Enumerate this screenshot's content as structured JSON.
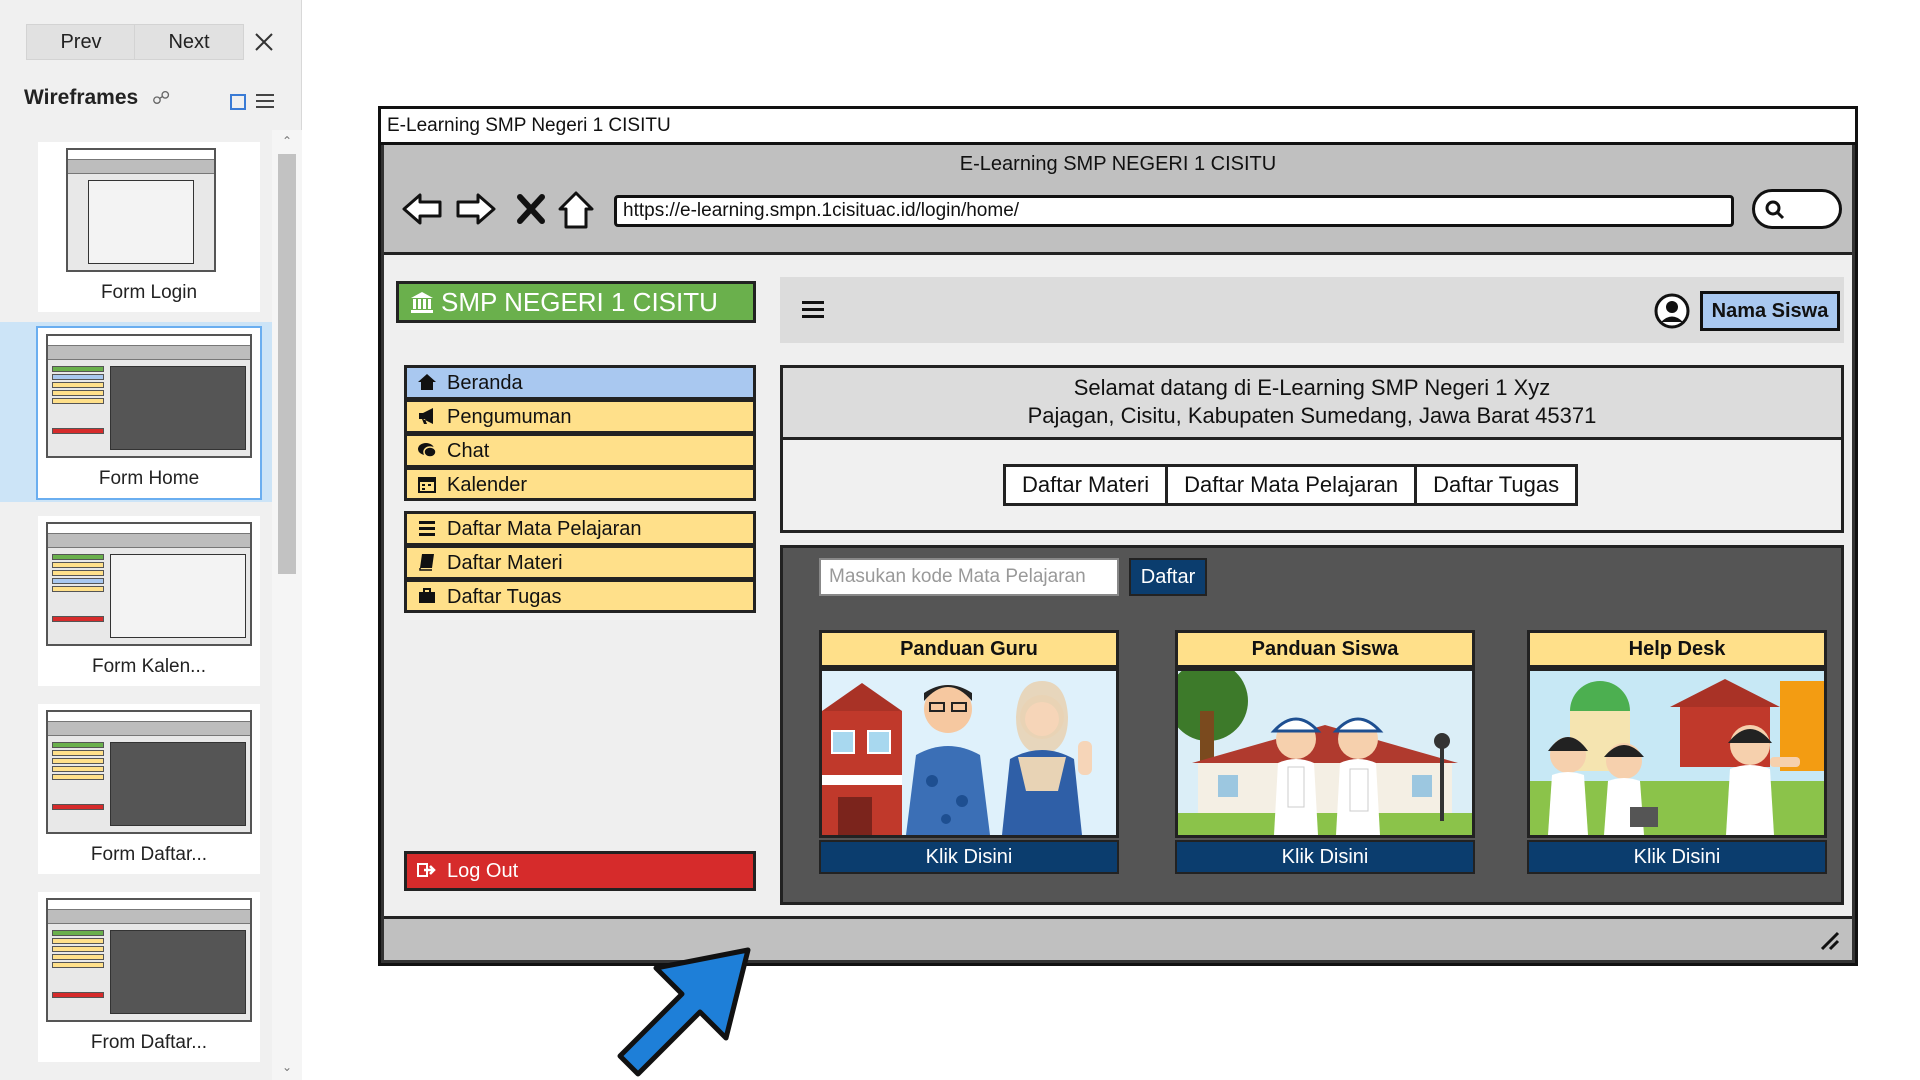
{
  "left_panel": {
    "prev_label": "Prev",
    "next_label": "Next",
    "header_title": "Wireframes",
    "thumbnails": [
      {
        "label": "Form Login"
      },
      {
        "label": "Form Home"
      },
      {
        "label": "Form Kalen..."
      },
      {
        "label": "Form Daftar..."
      },
      {
        "label": "From Daftar..."
      }
    ]
  },
  "mockup": {
    "window_title": "E-Learning SMP Negeri 1 CISITU",
    "page_title": "E-Learning SMP NEGERI 1 CISITU",
    "url": "https://e-learning.smpn.1cisituac.id/login/home/",
    "logo_text": "SMP NEGERI 1 CISITU",
    "menu_main": [
      {
        "label": "Beranda",
        "icon": "home-icon"
      },
      {
        "label": "Pengumuman",
        "icon": "megaphone-icon"
      },
      {
        "label": "Chat",
        "icon": "chat-icon"
      },
      {
        "label": "Kalender",
        "icon": "calendar-icon"
      }
    ],
    "menu_list": [
      {
        "label": "Daftar Mata Pelajaran",
        "icon": "list-icon"
      },
      {
        "label": "Daftar Materi",
        "icon": "book-icon"
      },
      {
        "label": "Daftar Tugas",
        "icon": "briefcase-icon"
      }
    ],
    "logout_label": "Log Out",
    "student_name": "Nama Siswa",
    "welcome_line1": "Selamat datang di E-Learning SMP Negeri 1 Xyz",
    "welcome_line2": "Pajagan, Cisitu, Kabupaten Sumedang, Jawa Barat 45371",
    "tabs": [
      "Daftar Materi",
      "Daftar Mata Pelajaran",
      "Daftar Tugas"
    ],
    "course_code_placeholder": "Masukan kode Mata Pelajaran",
    "join_label": "Daftar",
    "cards": [
      {
        "title": "Panduan Guru",
        "button": "Klik Disini"
      },
      {
        "title": "Panduan Siswa",
        "button": "Klik Disini"
      },
      {
        "title": "Help Desk",
        "button": "Klik Disini"
      }
    ],
    "colors": {
      "sidebar_item": "#ffe08a",
      "active_item": "#a9c8f0",
      "logo_green": "#6ab04c",
      "logout_red": "#d62b2b",
      "button_navy": "#0b3d6e",
      "arrow_blue": "#1e7fd8"
    }
  }
}
